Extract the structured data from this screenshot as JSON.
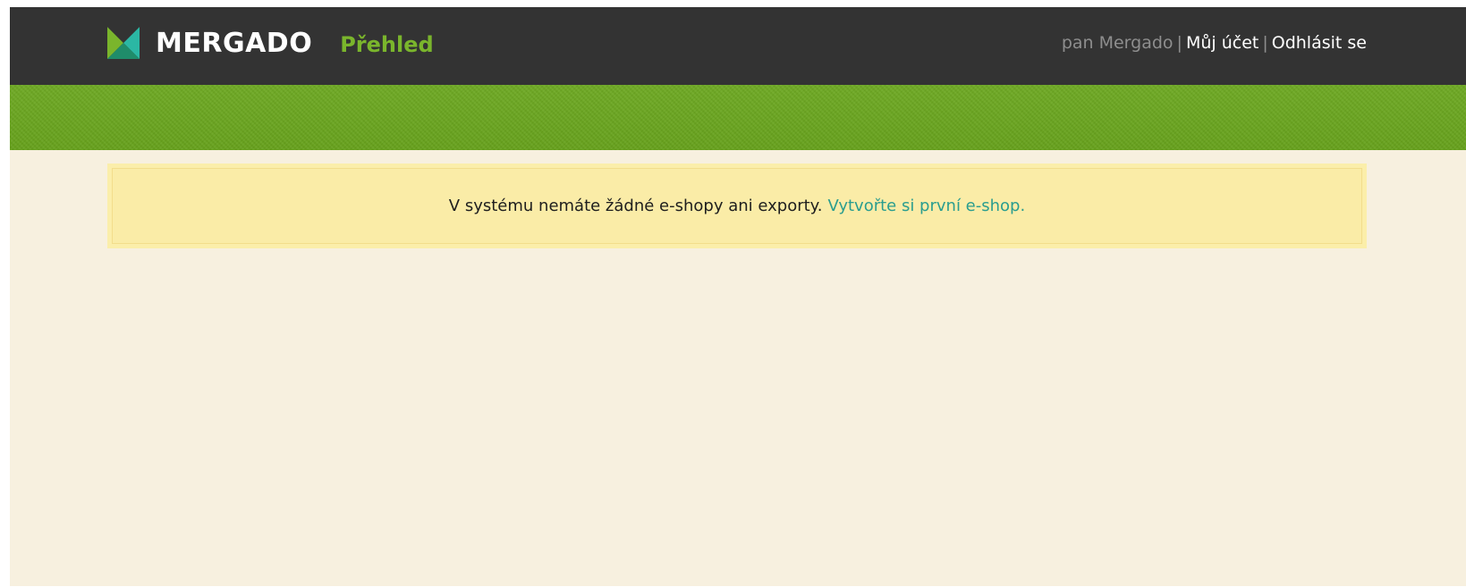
{
  "header": {
    "logo_text": "MERGADO",
    "section_title": "Přehled",
    "user_name": "pan Mergado",
    "separator": "|",
    "account_link": "Můj účet",
    "logout_link": "Odhlásit se"
  },
  "notice": {
    "message": "V systému nemáte žádné e-shopy ani exporty.",
    "link_text": "Vytvořte si první e-shop."
  },
  "colors": {
    "topbar": "#333333",
    "accent_green": "#7ab52c",
    "banner_green": "#6aa520",
    "page_background": "#f7f0df",
    "notice_background": "#faeca7",
    "link_teal": "#2a9d8f"
  }
}
